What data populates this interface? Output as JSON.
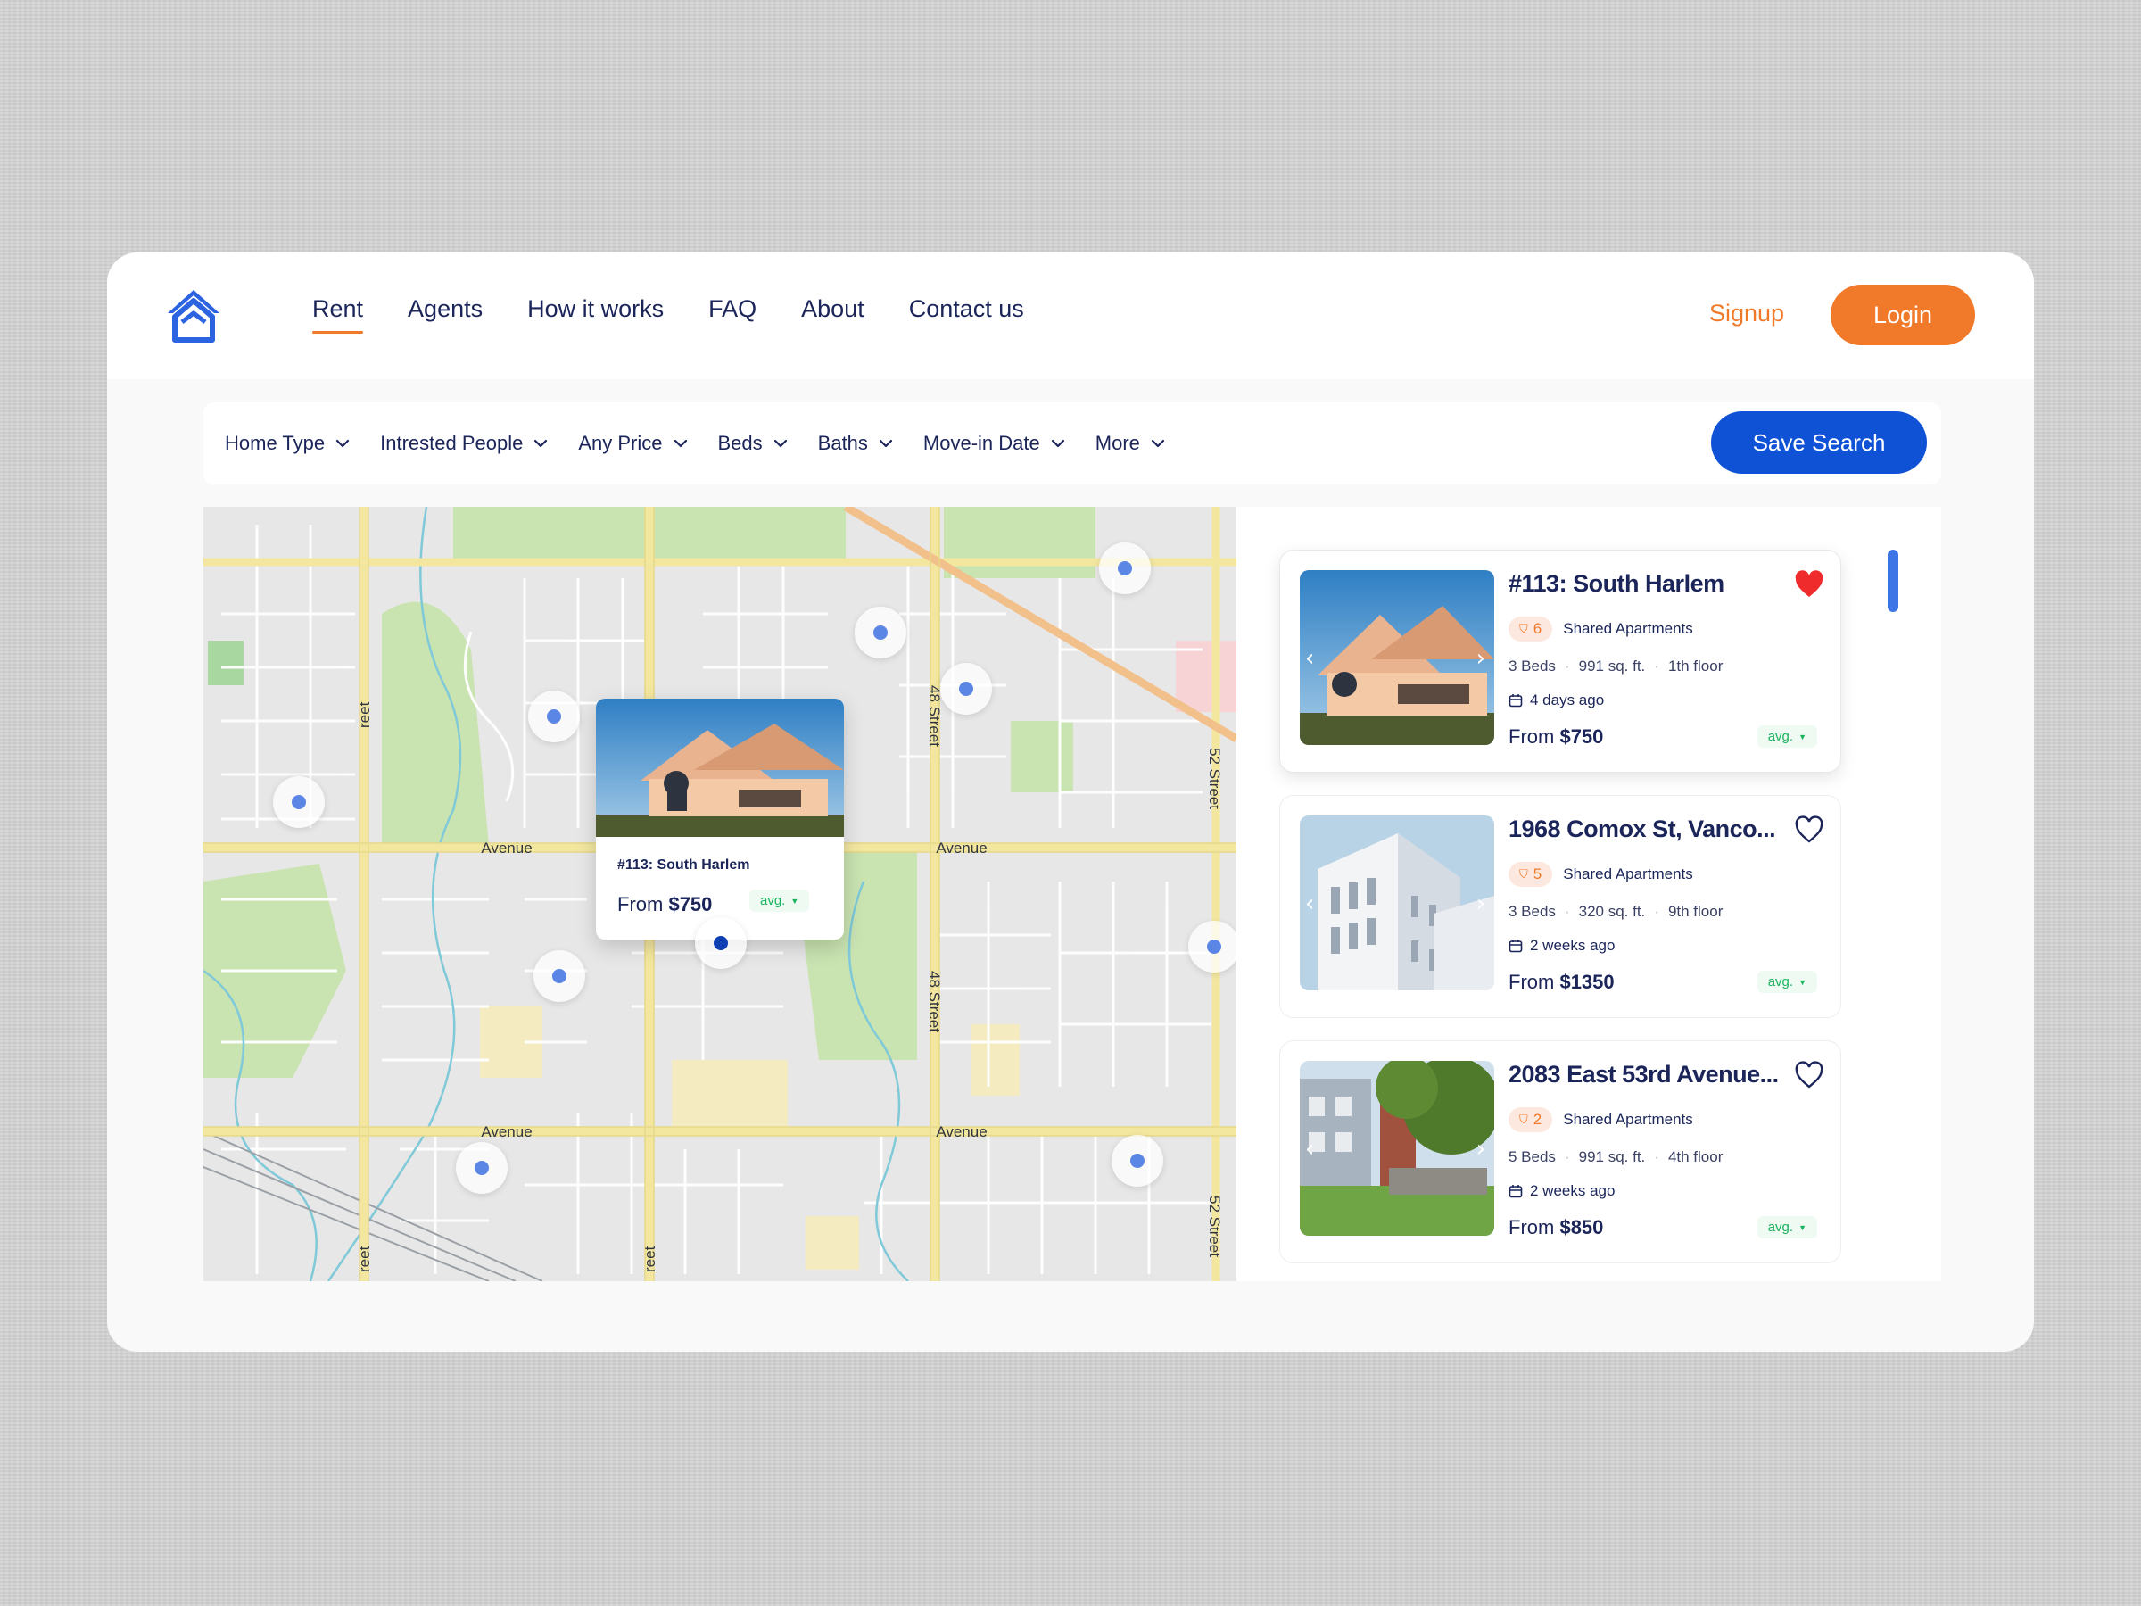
{
  "nav": {
    "items": [
      {
        "label": "Rent"
      },
      {
        "label": "Agents"
      },
      {
        "label": "How it works"
      },
      {
        "label": "FAQ"
      },
      {
        "label": "About"
      },
      {
        "label": "Contact us"
      }
    ],
    "active": "Rent",
    "signup_label": "Signup",
    "login_label": "Login"
  },
  "filters": {
    "items": [
      {
        "label": "Home Type"
      },
      {
        "label": "Intrested People"
      },
      {
        "label": "Any Price"
      },
      {
        "label": "Beds"
      },
      {
        "label": "Baths"
      },
      {
        "label": "Move-in Date"
      },
      {
        "label": "More"
      }
    ],
    "save_label": "Save Search"
  },
  "map": {
    "street_labels": {
      "avenue": "Avenue",
      "street_48": "48 Street",
      "street_52": "52 Street",
      "street_partial": "reet"
    },
    "popup": {
      "title": "#113: South Harlem",
      "price_prefix": "From ",
      "price": "$750",
      "avg_label": "avg."
    }
  },
  "listings": [
    {
      "title": "#113: South Harlem",
      "favorited": true,
      "interested": "6",
      "type": "Shared Apartments",
      "beds": "3 Beds",
      "area": "991 sq. ft.",
      "floor": "1th floor",
      "posted": "4 days ago",
      "price_prefix": "From ",
      "price": "$750",
      "avg_label": "avg."
    },
    {
      "title": "1968 Comox St, Vanco...",
      "favorited": false,
      "interested": "5",
      "type": "Shared Apartments",
      "beds": "3 Beds",
      "area": "320 sq. ft.",
      "floor": "9th floor",
      "posted": "2 weeks ago",
      "price_prefix": "From ",
      "price": "$1350",
      "avg_label": "avg."
    },
    {
      "title": "2083 East 53rd Avenue...",
      "favorited": false,
      "interested": "2",
      "type": "Shared Apartments",
      "beds": "5 Beds",
      "area": "991 sq. ft.",
      "floor": "4th floor",
      "posted": "2 weeks ago",
      "price_prefix": "From ",
      "price": "$850",
      "avg_label": "avg."
    }
  ],
  "colors": {
    "brand_blue": "#0f52d6",
    "accent_orange": "#f07a2a",
    "text_navy": "#1b2559",
    "avg_green": "#1bb35e",
    "heart_red": "#ef2b2b"
  }
}
